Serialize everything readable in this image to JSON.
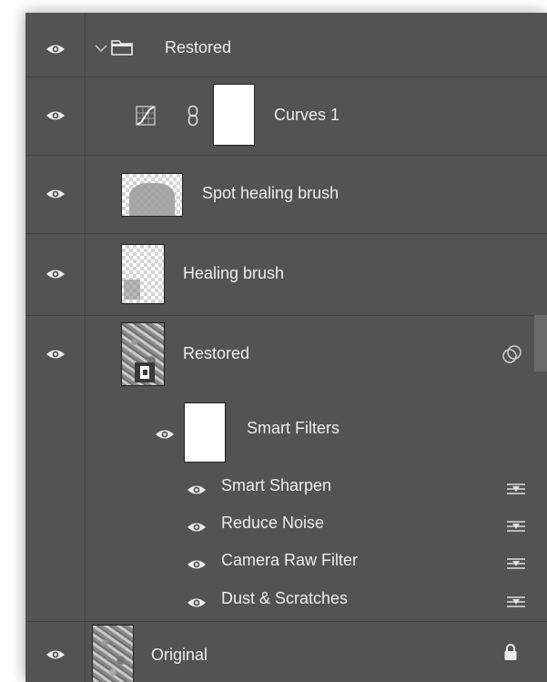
{
  "layers": [
    {
      "name": "Restored"
    },
    {
      "name": "Curves 1"
    },
    {
      "name": "Spot healing brush"
    },
    {
      "name": "Healing brush"
    },
    {
      "name": "Restored"
    },
    {
      "name": "Original"
    }
  ],
  "smart_filters": {
    "label": "Smart Filters",
    "items": [
      {
        "name": "Smart Sharpen"
      },
      {
        "name": "Reduce Noise"
      },
      {
        "name": "Camera Raw Filter"
      },
      {
        "name": "Dust & Scratches"
      }
    ]
  },
  "colors": {
    "panel_bg": "#535353",
    "separator": "#424242",
    "text": "#ececec"
  },
  "icons": [
    "eye-icon",
    "chevron-down-icon",
    "folder-icon",
    "curves-adjustment-icon",
    "link-icon",
    "smart-object-icon",
    "smart-object-badge-icon",
    "filter-options-icon",
    "lock-icon"
  ]
}
